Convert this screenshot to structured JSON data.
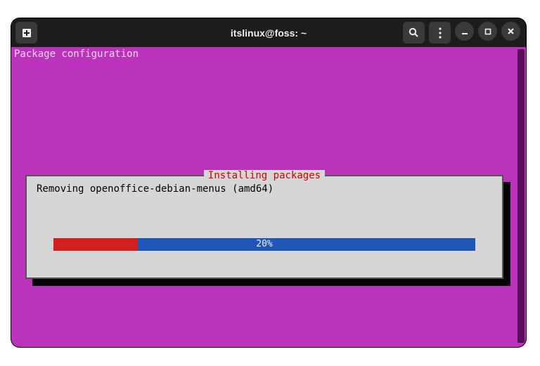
{
  "window": {
    "title": "itslinux@foss: ~"
  },
  "terminal": {
    "header": "Package configuration"
  },
  "dialog": {
    "title": "Installing packages",
    "message": "Removing openoffice-debian-menus (amd64)",
    "progress_percent": 20,
    "progress_label": "20%"
  }
}
